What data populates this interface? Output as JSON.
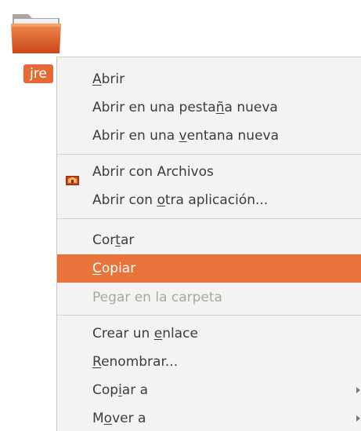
{
  "desktop": {
    "folder_icon": "folder-icon",
    "file_label": "jre",
    "accent_color": "#e8743b"
  },
  "menu": {
    "items": [
      {
        "pre": "",
        "mn": "A",
        "post": "brir"
      },
      {
        "pre": "Abrir en una pesta",
        "mn": "ñ",
        "post": "a nueva"
      },
      {
        "pre": "Abrir en una ",
        "mn": "v",
        "post": "entana nueva"
      },
      {
        "pre": "Abrir con Archivos",
        "mn": "",
        "post": "",
        "icon": "files-app-icon"
      },
      {
        "pre": "Abrir con ",
        "mn": "o",
        "post": "tra aplicación..."
      },
      {
        "pre": "Cor",
        "mn": "t",
        "post": "ar"
      },
      {
        "pre": "",
        "mn": "C",
        "post": "opiar",
        "state": "highlighted"
      },
      {
        "pre": "Pegar en la carpeta",
        "mn": "",
        "post": "",
        "state": "disabled"
      },
      {
        "pre": "Crear un ",
        "mn": "e",
        "post": "nlace"
      },
      {
        "pre": "",
        "mn": "R",
        "post": "enombrar..."
      },
      {
        "pre": "Cop",
        "mn": "i",
        "post": "ar a",
        "submenu": true
      },
      {
        "pre": "M",
        "mn": "o",
        "post": "ver a",
        "submenu": true
      }
    ]
  }
}
